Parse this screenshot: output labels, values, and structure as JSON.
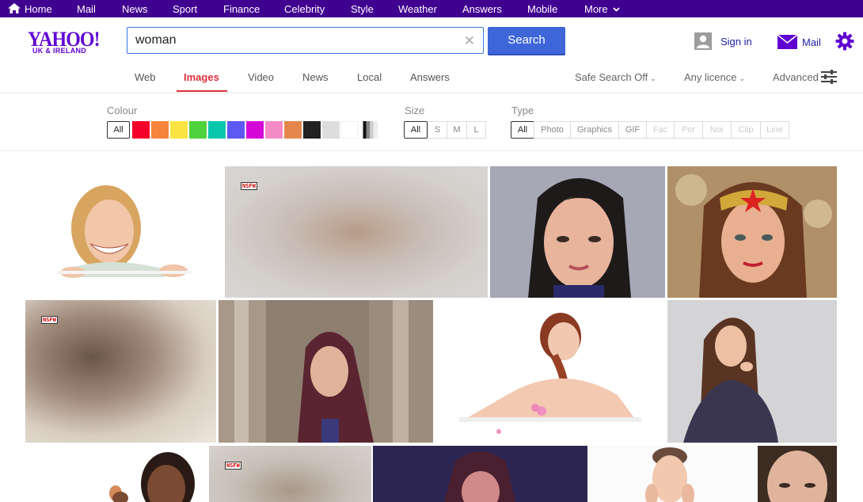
{
  "topnav": {
    "items": [
      "Home",
      "Mail",
      "News",
      "Sport",
      "Finance",
      "Celebrity",
      "Style",
      "Weather",
      "Answers",
      "Mobile",
      "More"
    ]
  },
  "header": {
    "logo_word": "YAHOO!",
    "logo_sub": "UK & IRELAND",
    "search_value": "woman",
    "search_button": "Search",
    "signin_label": "Sign in",
    "mail_label": "Mail"
  },
  "vertical_tabs": [
    "Web",
    "Images",
    "Video",
    "News",
    "Local",
    "Answers"
  ],
  "active_tab": "Images",
  "dropdowns": {
    "safe_search": "Safe Search Off",
    "licence": "Any licence",
    "advanced": "Advanced"
  },
  "filters": {
    "colour_label": "Colour",
    "colour_all": "All",
    "colours": [
      "#f5002a",
      "#f7843b",
      "#fae442",
      "#4fd33c",
      "#09c7ac",
      "#5e58f5",
      "#d506d8",
      "#f58bc6",
      "#e5874d",
      "#222222",
      "#dddddd",
      "#ffffff"
    ],
    "size_label": "Size",
    "sizes": [
      "All",
      "S",
      "M",
      "L"
    ],
    "type_label": "Type",
    "types": [
      "All",
      "Photo",
      "Graphics",
      "GIF",
      "Fac",
      "Por",
      "Nor",
      "Clip",
      "Line"
    ]
  },
  "nsfw_tag": "NSFW"
}
